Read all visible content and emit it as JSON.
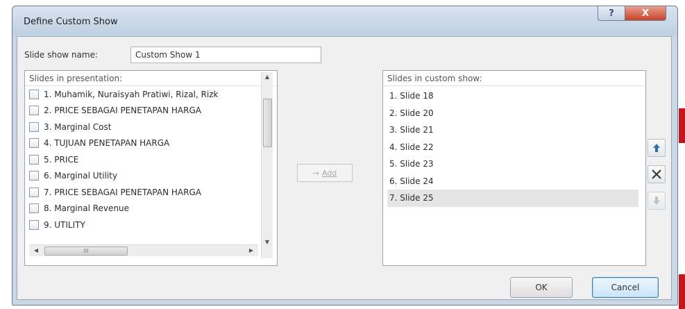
{
  "window": {
    "title": "Define Custom Show",
    "help_glyph": "?",
    "close_glyph": "X"
  },
  "show_name": {
    "label": "Slide show name:",
    "value": "Custom Show 1"
  },
  "presentation": {
    "header": "Slides in presentation:",
    "items": [
      "1. Muhamik, Nuraisyah Pratiwi, Rizal, Rizk",
      "2. PRICE SEBAGAI PENETAPAN HARGA",
      "3. Marginal Cost",
      "4. TUJUAN PENETAPAN HARGA",
      "5. PRICE",
      "6. Marginal Utility",
      "7. PRICE SEBAGAI PENETAPAN HARGA",
      "8. Marginal Revenue",
      "9. UTILITY"
    ],
    "scroll_thumb_text": "III"
  },
  "add_button": {
    "label": "Add",
    "icon": "add-arrow-icon"
  },
  "custom_show": {
    "header": "Slides in custom show:",
    "items": [
      "1. Slide 18",
      "2. Slide 20",
      "3. Slide 21",
      "4. Slide 22",
      "5. Slide 23",
      "6. Slide 24",
      "7. Slide 25"
    ],
    "selected_index": 6
  },
  "side_buttons": {
    "move_up": "up-arrow-icon",
    "remove": "remove-x-icon",
    "move_down": "down-arrow-icon"
  },
  "footer": {
    "ok": "OK",
    "cancel": "Cancel"
  },
  "colors": {
    "accent": "#3c7fb1",
    "close_red": "#c8442a",
    "selection": "#e5e5e5"
  }
}
